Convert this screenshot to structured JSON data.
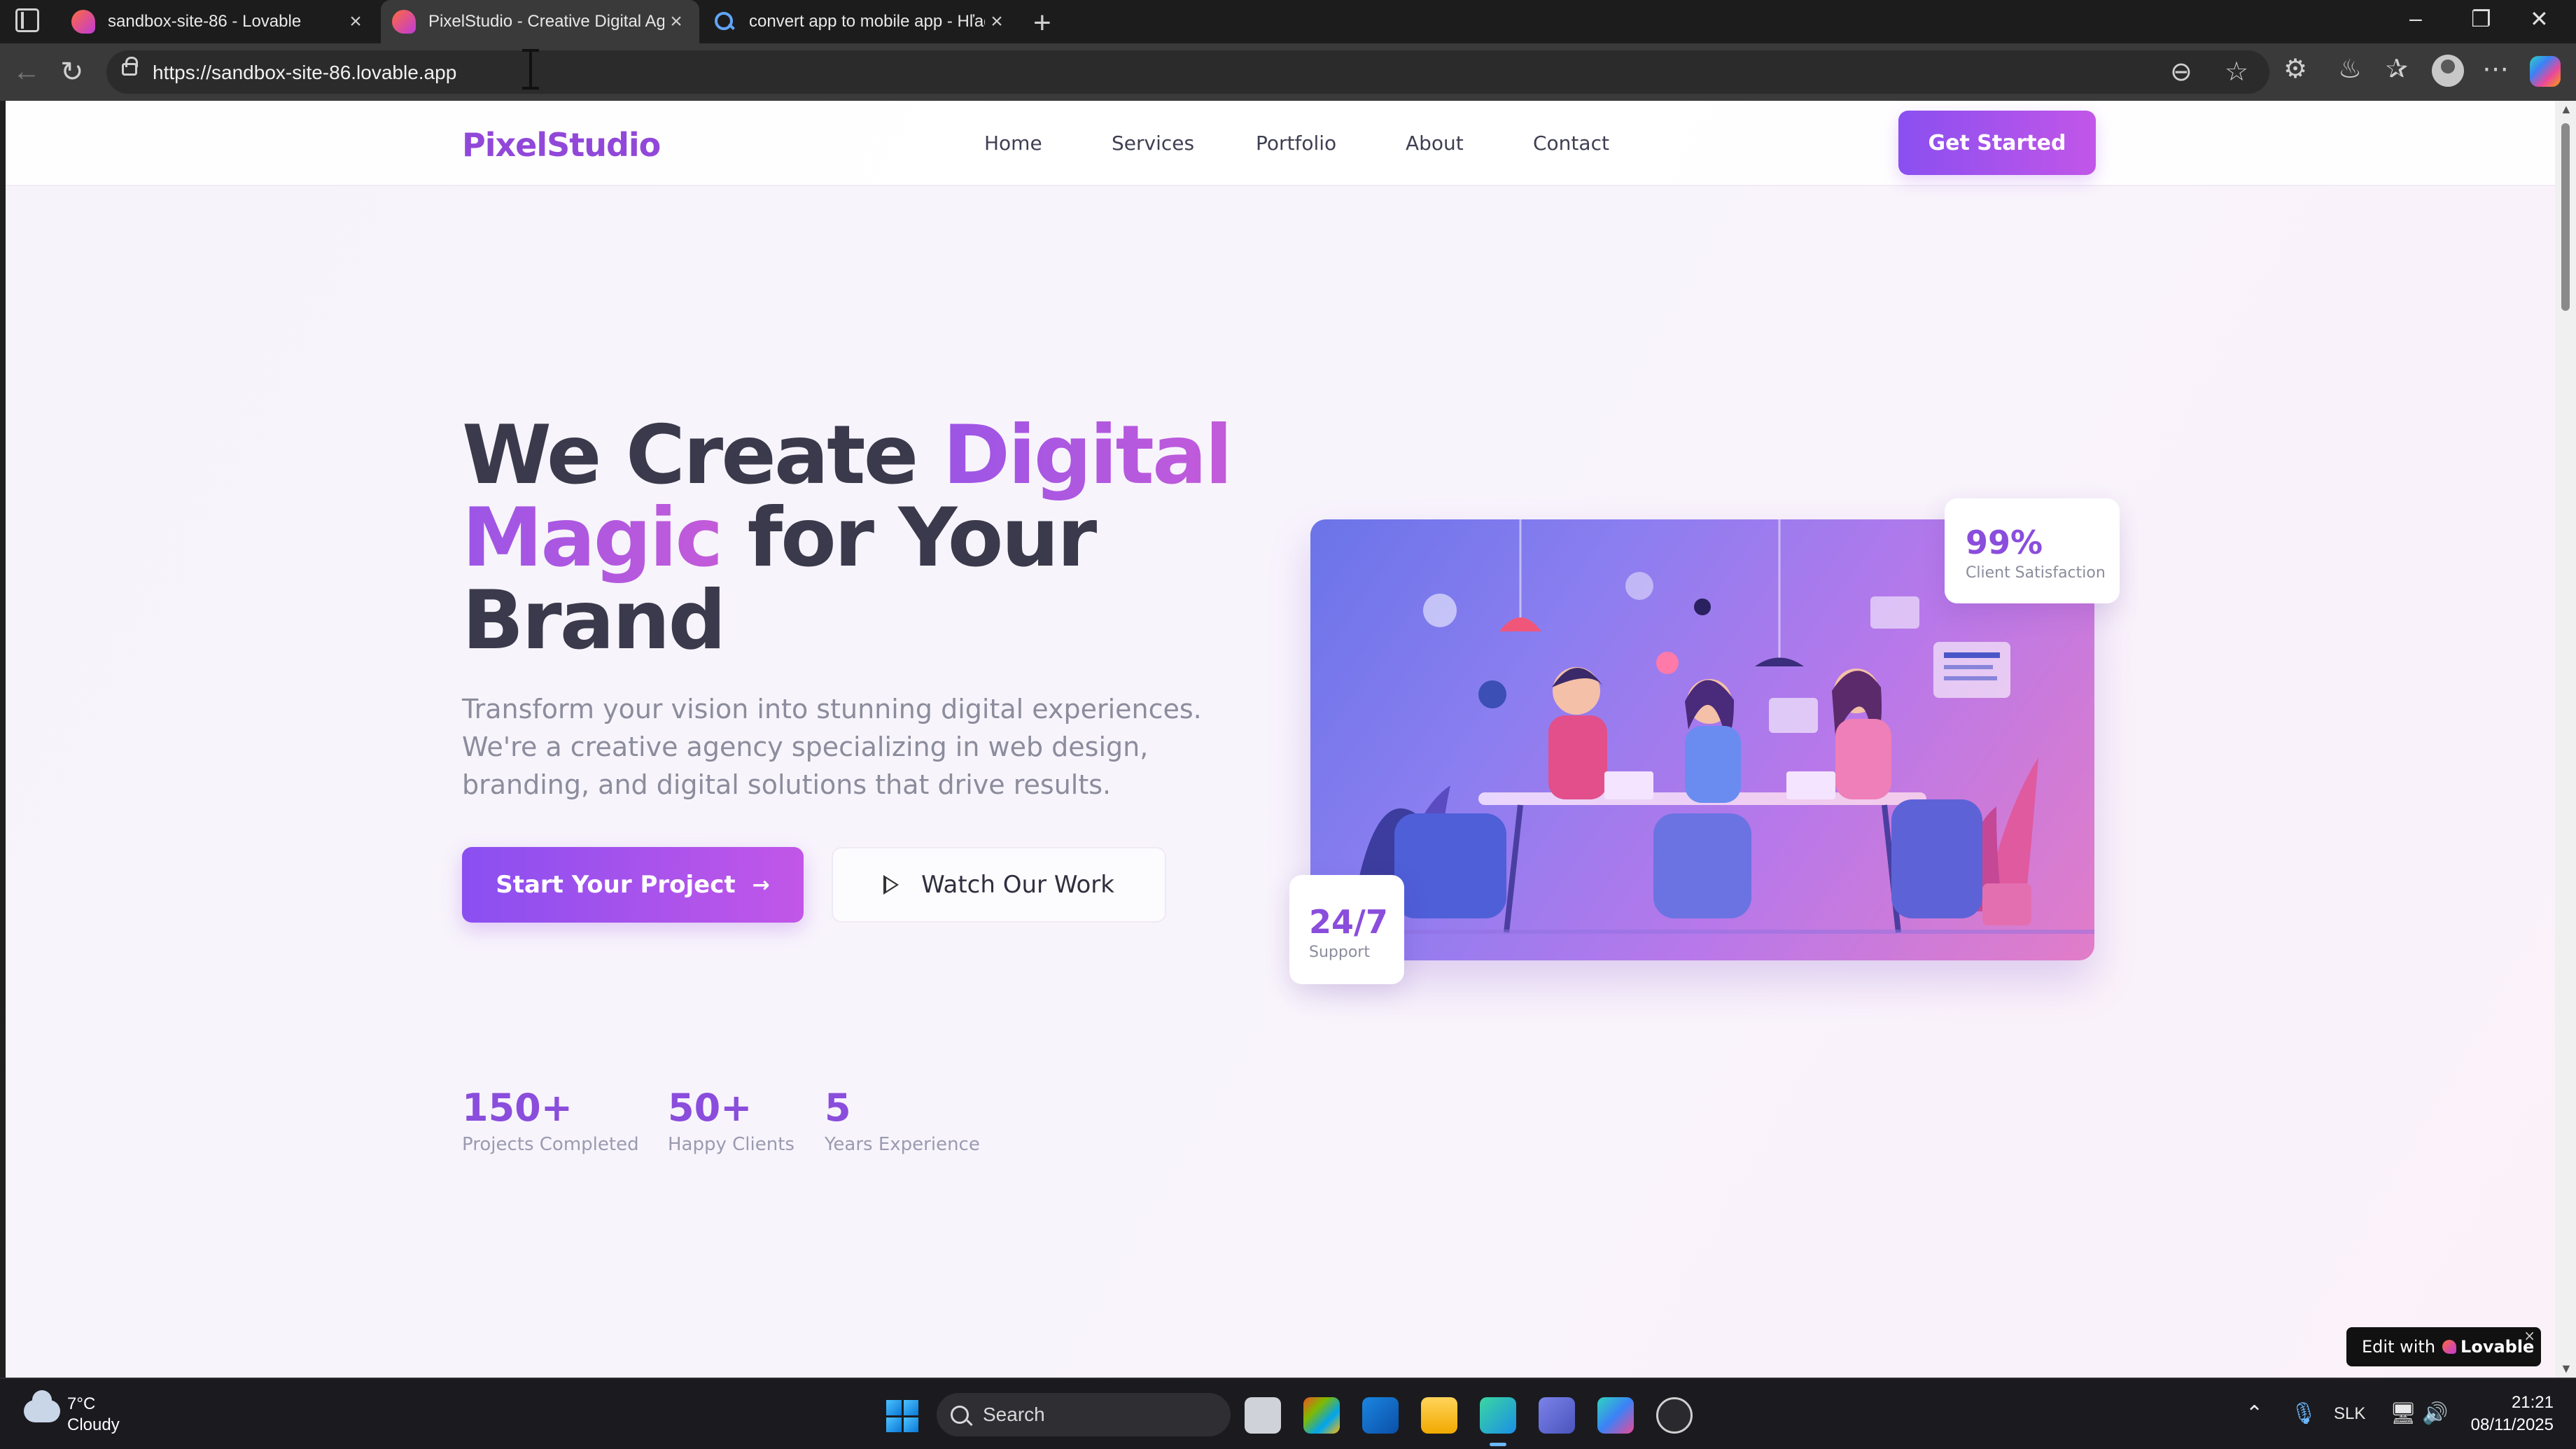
{
  "browser": {
    "tabs": [
      {
        "title": "sandbox-site-86 - Lovable",
        "active": false,
        "favicon": "lovable-icon"
      },
      {
        "title": "PixelStudio - Creative Digital Age",
        "active": true,
        "favicon": "lovable-icon"
      },
      {
        "title": "convert app to mobile app - Hľad",
        "active": false,
        "favicon": "search-icon"
      }
    ],
    "url": "https://sandbox-site-86.lovable.app"
  },
  "site": {
    "logo": "PixelStudio",
    "nav": [
      "Home",
      "Services",
      "Portfolio",
      "About",
      "Contact"
    ],
    "cta": "Get Started",
    "hero": {
      "title_part1": "We Create ",
      "title_highlight1": "Digital",
      "title_highlight2": "Magic",
      "title_part2": " for Your Brand",
      "description": "Transform your vision into stunning digital experiences. We're a creative agency specializing in web design, branding, and digital solutions that drive results.",
      "primary_button": "Start Your Project",
      "secondary_button": "Watch Our Work"
    },
    "stats": [
      {
        "value": "150+",
        "label": "Projects Completed"
      },
      {
        "value": "50+",
        "label": "Happy Clients"
      },
      {
        "value": "5",
        "label": "Years Experience"
      }
    ],
    "badges": {
      "satisfaction": {
        "value": "99%",
        "label": "Client Satisfaction"
      },
      "support": {
        "value": "24/7",
        "label": "Support"
      }
    },
    "edit_badge": {
      "prefix": "Edit with",
      "brand": "Lovable"
    },
    "colors": {
      "accent": "#8a4ddc",
      "accent_end": "#c256e8",
      "text_dark": "#3a3a4c",
      "text_muted": "#8b8c9c"
    }
  },
  "taskbar": {
    "weather": {
      "temp": "7°C",
      "desc": "Cloudy"
    },
    "search_placeholder": "Search",
    "language": "SLK",
    "time": "21:21",
    "date": "08/11/2025"
  }
}
